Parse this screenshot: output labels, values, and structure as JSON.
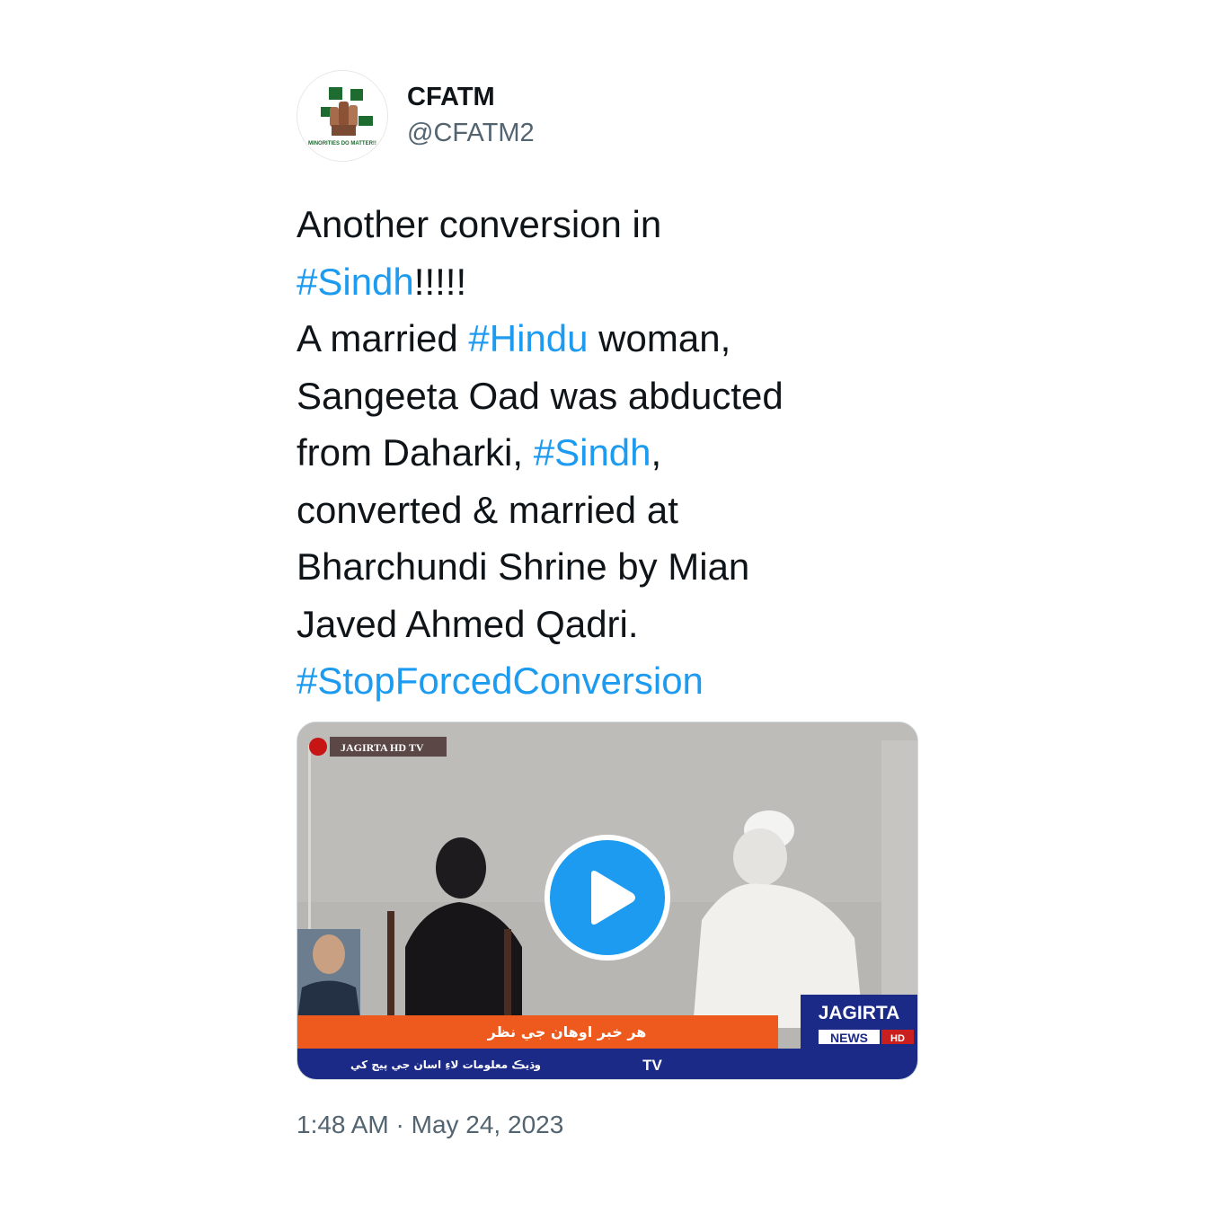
{
  "author": {
    "display_name": "CFATM",
    "handle": "@CFATM2",
    "avatar_icon": "fist-flags-logo-icon",
    "avatar_caption": "MINORITIES DO MATTER!!"
  },
  "tweet": {
    "lines": [
      [
        {
          "t": "Another conversion in",
          "tag": false
        }
      ],
      [
        {
          "t": "#Sindh",
          "tag": true
        },
        {
          "t": "!!!!!",
          "tag": false
        }
      ],
      [
        {
          "t": "A married ",
          "tag": false
        },
        {
          "t": "#Hindu",
          "tag": true
        },
        {
          "t": " woman,",
          "tag": false
        }
      ],
      [
        {
          "t": "Sangeeta Oad was abducted",
          "tag": false
        }
      ],
      [
        {
          "t": "from Daharki, ",
          "tag": false
        },
        {
          "t": "#Sindh",
          "tag": true
        },
        {
          "t": ",",
          "tag": false
        }
      ],
      [
        {
          "t": "converted & married at",
          "tag": false
        }
      ],
      [
        {
          "t": "Bharchundi Shrine by Mian",
          "tag": false
        }
      ],
      [
        {
          "t": "Javed Ahmed Qadri.",
          "tag": false
        }
      ],
      [
        {
          "t": "#StopForcedConversion",
          "tag": true
        }
      ]
    ],
    "timestamp": "1:48 AM · May 24, 2023"
  },
  "video": {
    "channel_label": "JAGIRTA HD TV",
    "ticker_text": "هر خبر اوهان جي نظر",
    "bottom_ticker_text": "وڌيڪ معلومات لاءِ اسان جي پيج کي",
    "bottom_ticker_tv": "TV",
    "brand_top": "JAGIRTA",
    "brand_news": "NEWS",
    "brand_hd": "HD"
  },
  "colors": {
    "link": "#1d9bf0",
    "text": "#0f1419",
    "secondary": "#536471",
    "ticker_orange": "#ee5a1d",
    "ticker_blue": "#1b2a86"
  }
}
